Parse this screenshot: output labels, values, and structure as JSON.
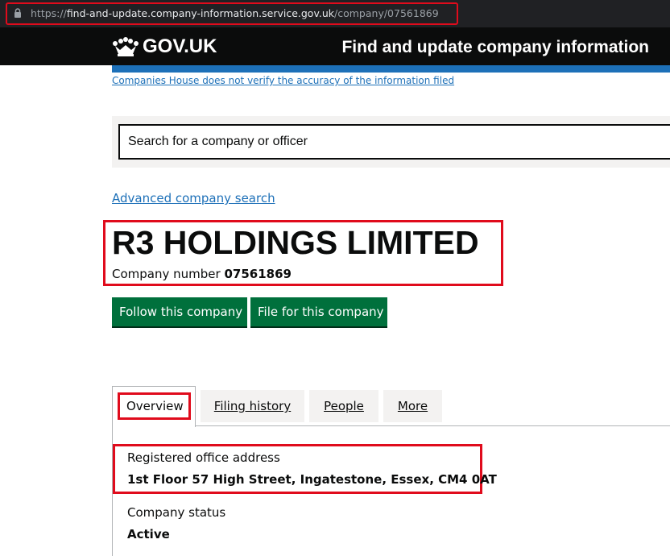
{
  "browser": {
    "url_scheme": "https://",
    "url_host": "find-and-update.company-information.service.gov.uk",
    "url_path": "/company/07561869"
  },
  "header": {
    "logotype": "GOV.UK",
    "service_name": "Find and update company information",
    "brand_color": "#1d70b8"
  },
  "disclaimer": "Companies House does not verify the accuracy of the information filed",
  "search": {
    "placeholder": "Search for a company or officer"
  },
  "advanced_search_link": "Advanced company search",
  "company": {
    "name": "R3 HOLDINGS LIMITED",
    "number_label": "Company number",
    "number": "07561869"
  },
  "actions": {
    "follow_label": "Follow this company",
    "file_label": "File for this company",
    "button_color": "#00703c"
  },
  "tabs": [
    {
      "label": "Overview"
    },
    {
      "label": "Filing history"
    },
    {
      "label": "People"
    },
    {
      "label": "More"
    }
  ],
  "overview": {
    "address_label": "Registered office address",
    "address_value": "1st Floor 57 High Street, Ingatestone, Essex, CM4 0AT",
    "status_label": "Company status",
    "status_value": "Active"
  },
  "icons": [
    "lock-icon",
    "crown-icon"
  ],
  "highlight_color": "#e00b1c"
}
